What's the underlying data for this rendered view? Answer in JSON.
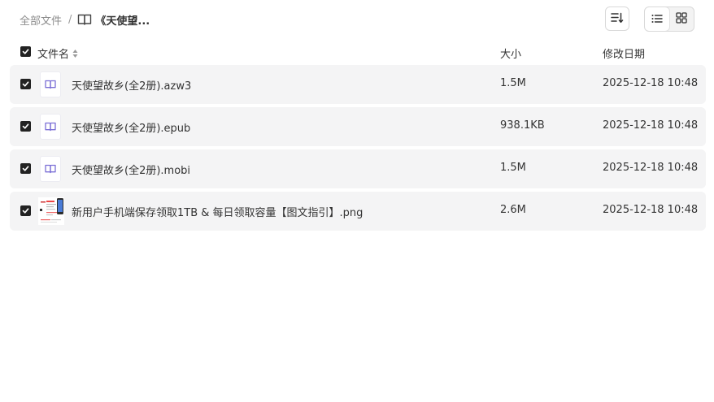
{
  "breadcrumb": {
    "root": "全部文件",
    "separator": "/",
    "current": "《天使望...",
    "current_icon": "book-icon"
  },
  "toolbar": {
    "sort_icon": "sort-icon",
    "view_list_icon": "list-view-icon",
    "view_grid_icon": "grid-view-icon"
  },
  "table": {
    "columns": {
      "name": "文件名",
      "size": "大小",
      "date": "修改日期"
    },
    "rows": [
      {
        "icon": "book-icon",
        "name": "天使望故乡(全2册).azw3",
        "size": "1.5M",
        "date": "2025-12-18 10:48",
        "checked": true
      },
      {
        "icon": "book-icon",
        "name": "天使望故乡(全2册).epub",
        "size": "938.1KB",
        "date": "2025-12-18 10:48",
        "checked": true
      },
      {
        "icon": "book-icon",
        "name": "天使望故乡(全2册).mobi",
        "size": "1.5M",
        "date": "2025-12-18 10:48",
        "checked": true
      },
      {
        "icon": "image-thumbnail",
        "name": "新用户手机端保存领取1TB & 每日领取容量【图文指引】.png",
        "size": "2.6M",
        "date": "2025-12-18 10:48",
        "checked": true
      }
    ]
  },
  "colors": {
    "row_background": "#f4f4f5",
    "checkbox": "#222222",
    "book_icon": "#7b6fd6",
    "muted_text": "#8c8c8c"
  }
}
